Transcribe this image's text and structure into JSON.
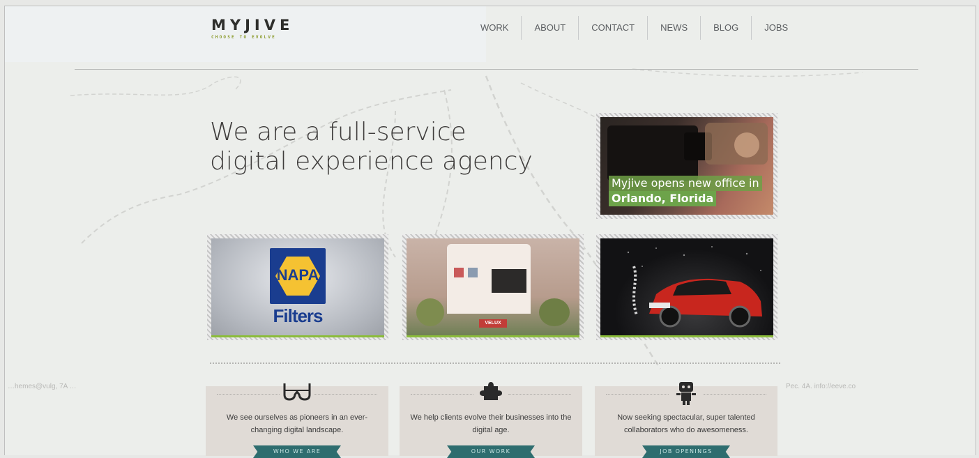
{
  "brand": {
    "name": "MYJIVE",
    "tagline": "CHOOSE TO EVOLVE"
  },
  "nav": {
    "items": [
      "WORK",
      "ABOUT",
      "CONTACT",
      "NEWS",
      "BLOG",
      "JOBS"
    ]
  },
  "hero": {
    "line1": "We are a full-service",
    "line2": "digital experience agency"
  },
  "news": {
    "line1": "Myjive opens new office in",
    "line2": "Orlando, Florida"
  },
  "portfolio": {
    "napa": {
      "logo": "NAPA",
      "word": "Filters"
    },
    "velux": {
      "badge": "VELUX"
    }
  },
  "cards": [
    {
      "text": "We see ourselves as pioneers in an ever-changing digital landscape.",
      "button": "WHO WE ARE"
    },
    {
      "text": "We help clients evolve their businesses into the digital age.",
      "button": "OUR WORK"
    },
    {
      "text": "Now seeking spectacular, super talented collaborators who do awesomeness.",
      "button": "JOB OPENINGS"
    }
  ],
  "side_fragments": {
    "left": "…hemes@vulg, 7A …",
    "right": "Pec. 4A. info://eeve.co"
  },
  "colors": {
    "accent_green": "#8bbc3a",
    "ribbon_teal": "#2e6d6f",
    "card_bg": "#e0dbd6"
  }
}
